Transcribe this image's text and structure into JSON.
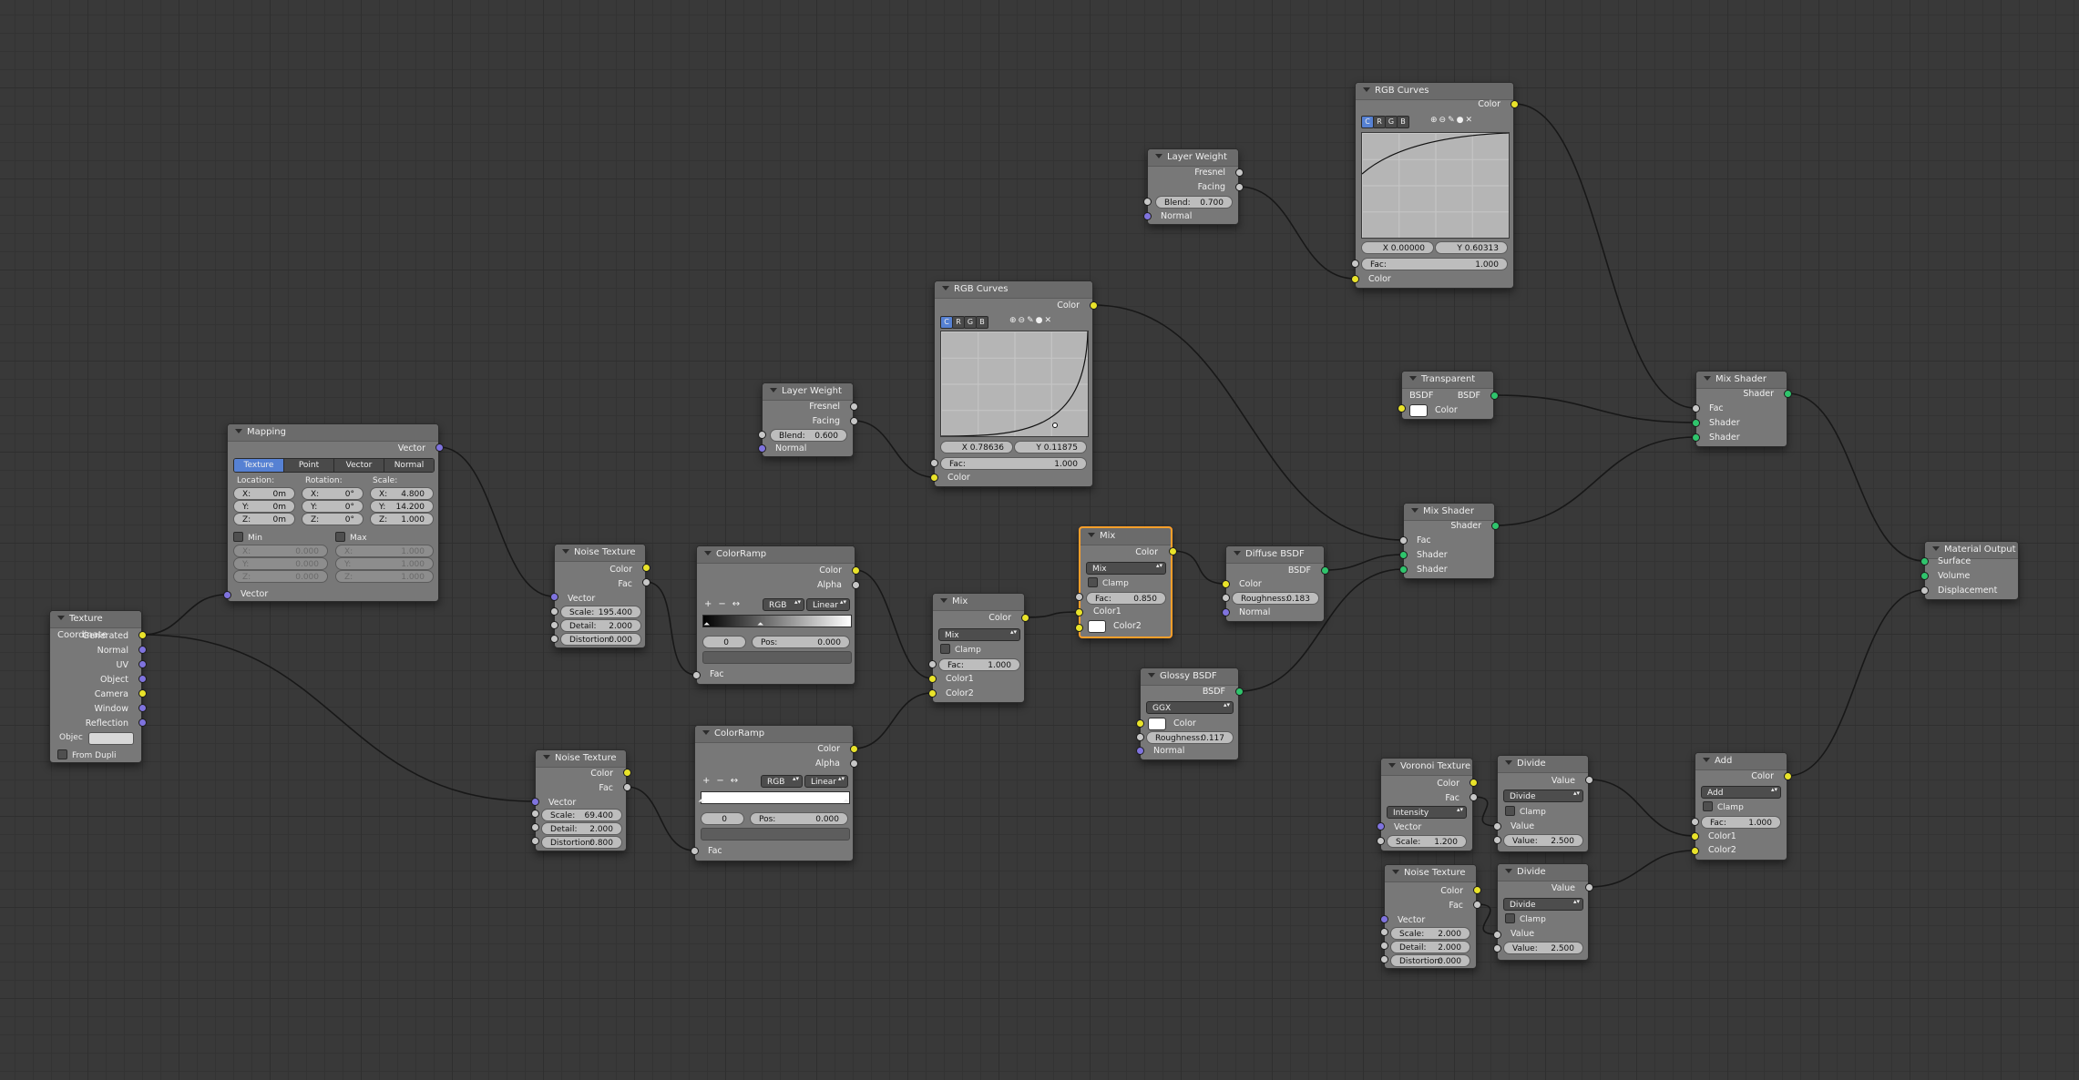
{
  "texture_coordinate": {
    "title": "Texture Coordinate",
    "outputs": [
      "Generated",
      "Normal",
      "UV",
      "Object",
      "Camera",
      "Window",
      "Reflection"
    ],
    "object_label": "Objec",
    "from_dupli": "From Dupli"
  },
  "mapping": {
    "title": "Mapping",
    "output": "Vector",
    "tabs": [
      "Texture",
      "Point",
      "Vector",
      "Normal"
    ],
    "active_tab": "Texture",
    "location_label": "Location:",
    "rotation_label": "Rotation:",
    "scale_label": "Scale:",
    "loc": [
      {
        "l": "X:",
        "v": "0m"
      },
      {
        "l": "Y:",
        "v": "0m"
      },
      {
        "l": "Z:",
        "v": "0m"
      }
    ],
    "rot": [
      {
        "l": "X:",
        "v": "0°"
      },
      {
        "l": "Y:",
        "v": "0°"
      },
      {
        "l": "Z:",
        "v": "0°"
      }
    ],
    "scale": [
      {
        "l": "X:",
        "v": "4.800"
      },
      {
        "l": "Y:",
        "v": "14.200"
      },
      {
        "l": "Z:",
        "v": "1.000"
      }
    ],
    "min_label": "Min",
    "max_label": "Max",
    "min": [
      {
        "l": "X:",
        "v": "0.000"
      },
      {
        "l": "Y:",
        "v": "0.000"
      },
      {
        "l": "Z:",
        "v": "0.000"
      }
    ],
    "max": [
      {
        "l": "X:",
        "v": "1.000"
      },
      {
        "l": "Y:",
        "v": "1.000"
      },
      {
        "l": "Z:",
        "v": "1.000"
      }
    ],
    "input": "Vector"
  },
  "noise1": {
    "title": "Noise Texture",
    "out_color": "Color",
    "out_fac": "Fac",
    "in_vector": "Vector",
    "scale": {
      "l": "Scale:",
      "v": "195.400"
    },
    "detail": {
      "l": "Detail:",
      "v": "2.000"
    },
    "distortion": {
      "l": "Distortion:",
      "v": "0.000"
    }
  },
  "noise2": {
    "title": "Noise Texture",
    "out_color": "Color",
    "out_fac": "Fac",
    "in_vector": "Vector",
    "scale": {
      "l": "Scale:",
      "v": "69.400"
    },
    "detail": {
      "l": "Detail:",
      "v": "2.000"
    },
    "distortion": {
      "l": "Distortion:",
      "v": "0.800"
    }
  },
  "noise3": {
    "title": "Noise Texture",
    "out_color": "Color",
    "out_fac": "Fac",
    "in_vector": "Vector",
    "scale": {
      "l": "Scale:",
      "v": "2.000"
    },
    "detail": {
      "l": "Detail:",
      "v": "2.000"
    },
    "distortion": {
      "l": "Distortion:",
      "v": "0.000"
    }
  },
  "ramp1": {
    "title": "ColorRamp",
    "out_color": "Color",
    "out_alpha": "Alpha",
    "mode": "RGB",
    "interp": "Linear",
    "index": "0",
    "pos_label": "Pos:",
    "pos": "0.000",
    "in_fac": "Fac"
  },
  "ramp2": {
    "title": "ColorRamp",
    "out_color": "Color",
    "out_alpha": "Alpha",
    "mode": "RGB",
    "interp": "Linear",
    "index": "0",
    "pos_label": "Pos:",
    "pos": "0.000",
    "in_fac": "Fac"
  },
  "layer1": {
    "title": "Layer Weight",
    "out_fresnel": "Fresnel",
    "out_facing": "Facing",
    "blend": {
      "l": "Blend:",
      "v": "0.600"
    },
    "in_normal": "Normal"
  },
  "layer2": {
    "title": "Layer Weight",
    "out_fresnel": "Fresnel",
    "out_facing": "Facing",
    "blend": {
      "l": "Blend:",
      "v": "0.700"
    },
    "in_normal": "Normal"
  },
  "curves1": {
    "title": "RGB Curves",
    "out_color": "Color",
    "channels": [
      "C",
      "R",
      "G",
      "B"
    ],
    "tools": "⊕⊖✎●✕",
    "x": "X 0.78636",
    "y": "Y 0.11875",
    "fac": {
      "l": "Fac:",
      "v": "1.000"
    },
    "in_color": "Color"
  },
  "curves2": {
    "title": "RGB Curves",
    "out_color": "Color",
    "channels": [
      "C",
      "R",
      "G",
      "B"
    ],
    "tools": "⊕⊖✎●✕",
    "x": "X 0.00000",
    "y": "Y 0.60313",
    "fac": {
      "l": "Fac:",
      "v": "1.000"
    },
    "in_color": "Color"
  },
  "mix1": {
    "title": "Mix",
    "out_color": "Color",
    "mode": "Mix",
    "clamp": "Clamp",
    "fac": {
      "l": "Fac:",
      "v": "1.000"
    },
    "in_color1": "Color1",
    "in_color2": "Color2"
  },
  "mix2": {
    "title": "Mix",
    "out_color": "Color",
    "mode": "Mix",
    "clamp": "Clamp",
    "fac": {
      "l": "Fac:",
      "v": "0.850"
    },
    "in_color1": "Color1",
    "in_color2": "Color2"
  },
  "diffuse": {
    "title": "Diffuse BSDF",
    "out": "BSDF",
    "in_color": "Color",
    "roughness": {
      "l": "Roughness:",
      "v": "0.183"
    },
    "in_normal": "Normal"
  },
  "glossy": {
    "title": "Glossy BSDF",
    "out": "BSDF",
    "dist": "GGX",
    "in_color": "Color",
    "roughness": {
      "l": "Roughness:",
      "v": "0.117"
    },
    "in_normal": "Normal"
  },
  "transparent": {
    "title": "Transparent BSDF",
    "out": "BSDF",
    "in_color": "Color"
  },
  "mixshader1": {
    "title": "Mix Shader",
    "out": "Shader",
    "in_fac": "Fac",
    "in_s1": "Shader",
    "in_s2": "Shader"
  },
  "mixshader2": {
    "title": "Mix Shader",
    "out": "Shader",
    "in_fac": "Fac",
    "in_s1": "Shader",
    "in_s2": "Shader"
  },
  "output": {
    "title": "Material Output",
    "surface": "Surface",
    "volume": "Volume",
    "displacement": "Displacement"
  },
  "voronoi": {
    "title": "Voronoi Texture",
    "out_color": "Color",
    "out_fac": "Fac",
    "coloring": "Intensity",
    "in_vector": "Vector",
    "scale": {
      "l": "Scale:",
      "v": "1.200"
    }
  },
  "divide1": {
    "title": "Divide",
    "out": "Value",
    "op": "Divide",
    "clamp": "Clamp",
    "in_value": "Value",
    "value": {
      "l": "Value:",
      "v": "2.500"
    }
  },
  "divide2": {
    "title": "Divide",
    "out": "Value",
    "op": "Divide",
    "clamp": "Clamp",
    "in_value": "Value",
    "value": {
      "l": "Value:",
      "v": "2.500"
    }
  },
  "add": {
    "title": "Add",
    "out_color": "Color",
    "mode": "Add",
    "clamp": "Clamp",
    "fac": {
      "l": "Fac:",
      "v": "1.000"
    },
    "in_color1": "Color1",
    "in_color2": "Color2"
  },
  "colors": {
    "background": "#393939",
    "node": "#787878",
    "active_outline": "#ff9f2a",
    "socket_color": "#e9e32a",
    "socket_shader": "#2fc46c",
    "socket_vector": "#7f73de",
    "socket_float": "#c7c7c7"
  }
}
